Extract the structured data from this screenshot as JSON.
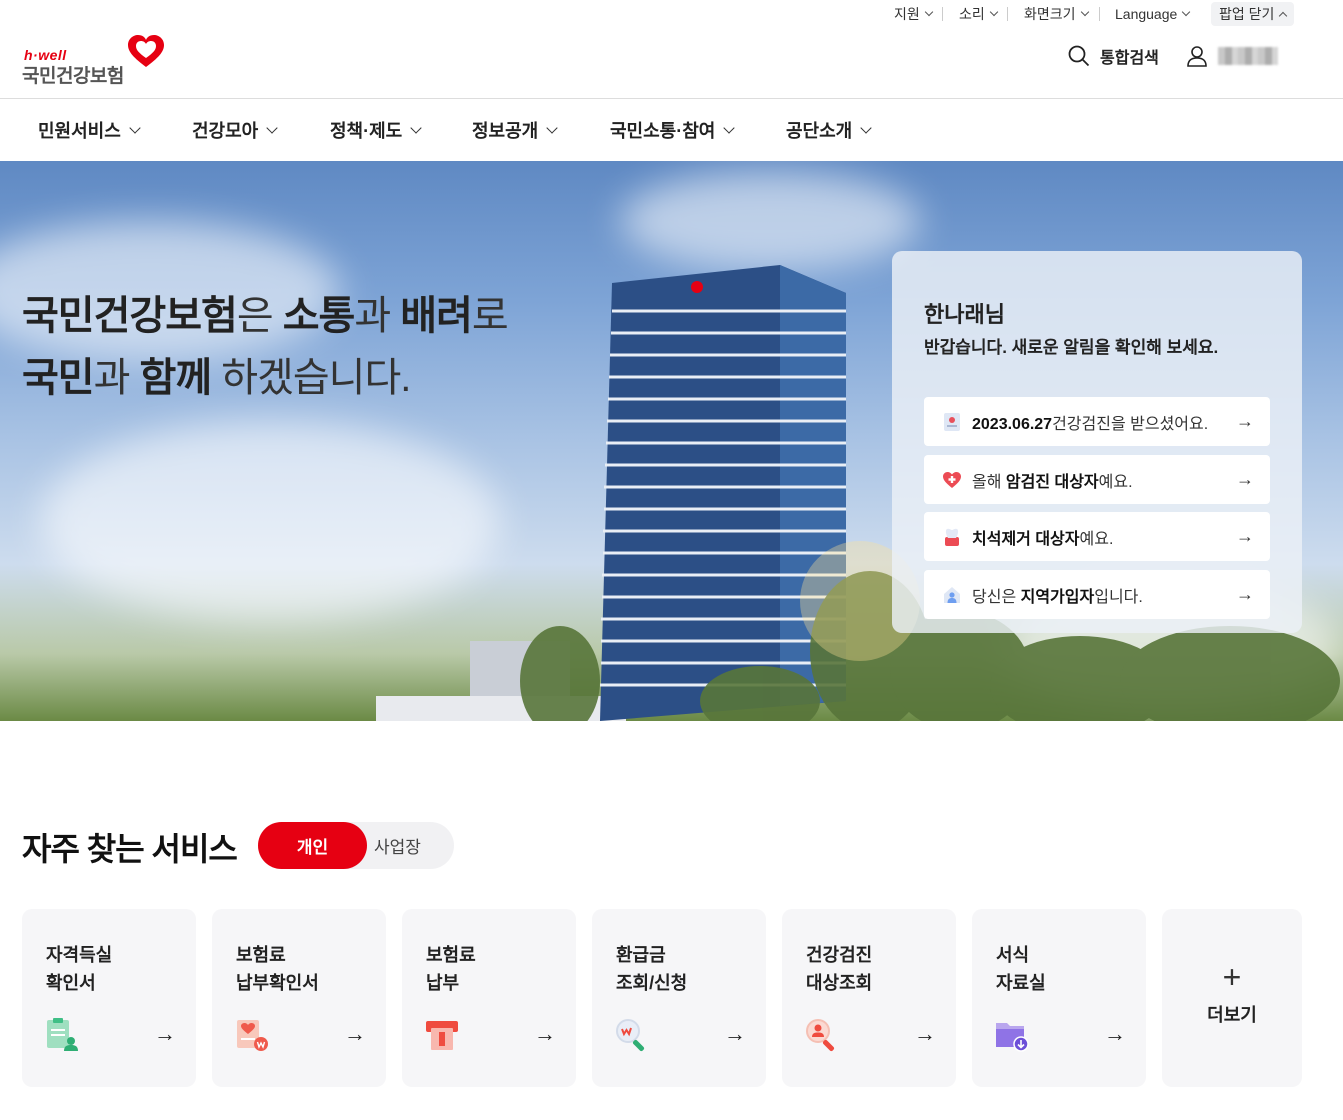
{
  "utility": {
    "support": "지원",
    "sound": "소리",
    "screen_size": "화면크기",
    "language": "Language",
    "popup_close": "팝업 닫기"
  },
  "logo": {
    "brand": "h·well",
    "name": "국민건강보험"
  },
  "header": {
    "search_label": "통합검색"
  },
  "gnb": [
    "민원서비스",
    "건강모아",
    "정책·제도",
    "정보공개",
    "국민소통·참여",
    "공단소개"
  ],
  "hero": {
    "line1": {
      "a": "국민건강보험",
      "b": "은 ",
      "c": "소통",
      "d": "과 ",
      "e": "배려",
      "f": "로"
    },
    "line2": {
      "a": "국민",
      "b": "과 ",
      "c": "함께",
      "d": " 하겠습니다."
    }
  },
  "notice": {
    "greeting": "한나래님",
    "subtitle": "반갑습니다. 새로운 알림을 확인해 보세요.",
    "items": [
      {
        "pre": "",
        "bold": "2023.06.27",
        "post": "건강검진을 받으셨어요.",
        "icon": "checkup-doc-icon"
      },
      {
        "pre": "올해 ",
        "bold": "암검진 대상자",
        "post": "예요.",
        "icon": "heart-plus-icon"
      },
      {
        "pre": "",
        "bold": "치석제거 대상자",
        "post": "예요.",
        "icon": "tooth-icon"
      },
      {
        "pre": "당신은 ",
        "bold": "지역가입자",
        "post": "입니다.",
        "icon": "home-person-icon"
      }
    ]
  },
  "services": {
    "title": "자주 찾는 서비스",
    "tab_personal": "개인",
    "tab_business": "사업장",
    "cards": [
      {
        "label": "자격득실\n확인서",
        "icon": "certificate-person-icon"
      },
      {
        "label": "보험료\n납부확인서",
        "icon": "payment-confirm-icon"
      },
      {
        "label": "보험료\n납부",
        "icon": "payment-card-icon"
      },
      {
        "label": "환급금\n조회/신청",
        "icon": "refund-search-icon"
      },
      {
        "label": "건강검진\n대상조회",
        "icon": "checkup-search-icon"
      },
      {
        "label": "서식\n자료실",
        "icon": "folder-download-icon"
      }
    ],
    "more_label": "더보기"
  },
  "colors": {
    "accent": "#e60012"
  }
}
